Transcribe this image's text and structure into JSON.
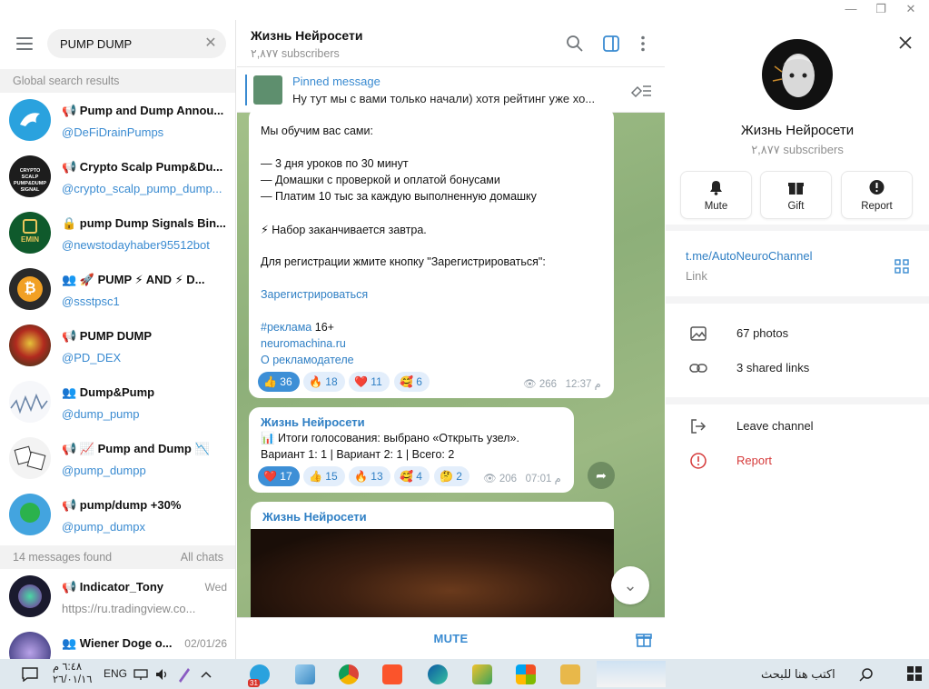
{
  "window": {
    "minimize": "—",
    "restore": "❐",
    "close": "✕"
  },
  "search": {
    "value": "PUMP DUMP",
    "clear": "✕"
  },
  "sections": {
    "global": "Global search results",
    "messages_found": "14 messages found",
    "all_chats": "All chats"
  },
  "global_results": [
    {
      "title": "📢 Pump and Dump Annou...",
      "sub": "@DeFiDrainPumps"
    },
    {
      "title": "📢 Crypto Scalp Pump&Du...",
      "sub": "@crypto_scalp_pump_dump...",
      "avatar_text": "CRYPTO SCALP PUMP&DUMP SIGNAL"
    },
    {
      "title": "🔒 pump Dump Signals Bin...",
      "sub": "@newstodayhaber95512bot",
      "avatar_text": "EMIN"
    },
    {
      "title": "👥 🚀 PUMP ⚡ AND ⚡ D...",
      "sub": "@ssstpsc1"
    },
    {
      "title": "📢 PUMP DUMP",
      "sub": "@PD_DEX"
    },
    {
      "title": "👥 Dump&Pump",
      "sub": "@dump_pump"
    },
    {
      "title": "📢 📈 Pump and Dump 📉",
      "sub": "@pump_dumpp"
    },
    {
      "title": "📢 pump/dump +30%",
      "sub": "@pump_dumpx"
    }
  ],
  "message_results": [
    {
      "title": "📢 Indicator_Tony",
      "sub": "https://ru.tradingview.co...",
      "date": "Wed"
    },
    {
      "title": "👥 Wiener Doge o...",
      "date": "02/01/26"
    }
  ],
  "chat": {
    "title": "Жизнь Нейросети",
    "subscribers": "٢,٨٧٧ subscribers",
    "pinned_label": "Pinned message",
    "pinned_text": "Ну тут мы с вами только начали) хотя рейтинг уже хо...",
    "msg1": {
      "lines": [
        "Мы обучим вас сами:",
        "— 3 дня уроков по 30 минут",
        "— Домашки с проверкой и оплатой бонусами",
        "— Платим 10 тыс за каждую выполненную домашку",
        "⚡ Набор заканчивается завтра.",
        "Для регистрации жмите кнопку \"Зарегистрироваться\":"
      ],
      "register_link": "Зарегистрироваться",
      "hashtag": "#реклама",
      "age": "16+",
      "site": "neuromachina.ru",
      "about": "О рекламодателе",
      "reactions": [
        {
          "emoji": "👍",
          "count": "36",
          "active": true
        },
        {
          "emoji": "🔥",
          "count": "18"
        },
        {
          "emoji": "❤️",
          "count": "11"
        },
        {
          "emoji": "🥰",
          "count": "6"
        }
      ],
      "views": "266",
      "time": "12:37 م"
    },
    "msg2": {
      "sender": "Жизнь Нейросети",
      "line1": "📊 Итоги голосования: выбрано «Открыть узел».",
      "line2": "Вариант 1: 1 | Вариант 2: 1 | Всего: 2",
      "reactions": [
        {
          "emoji": "❤️",
          "count": "17",
          "active": true
        },
        {
          "emoji": "👍",
          "count": "15"
        },
        {
          "emoji": "🔥",
          "count": "13"
        },
        {
          "emoji": "🥰",
          "count": "4"
        },
        {
          "emoji": "🤔",
          "count": "2"
        }
      ],
      "views": "206",
      "time": "07:01 م"
    },
    "msg3": {
      "sender": "Жизнь Нейросети"
    },
    "mute": "MUTE"
  },
  "profile": {
    "name": "Жизнь Нейросети",
    "subscribers": "٢,٨٧٧ subscribers",
    "actions": [
      {
        "label": "Mute"
      },
      {
        "label": "Gift"
      },
      {
        "label": "Report"
      }
    ],
    "link": "t.me/AutoNeuroChannel",
    "link_caption": "Link",
    "photos": "67 photos",
    "shared_links": "3 shared links",
    "leave": "Leave channel",
    "report": "Report"
  },
  "taskbar": {
    "search": "اكتب هنا للبحث",
    "lang": "ENG",
    "time": "٦:٤٨ م",
    "date": "٢٦/٠١/١٦",
    "telegram_badge": "31"
  }
}
